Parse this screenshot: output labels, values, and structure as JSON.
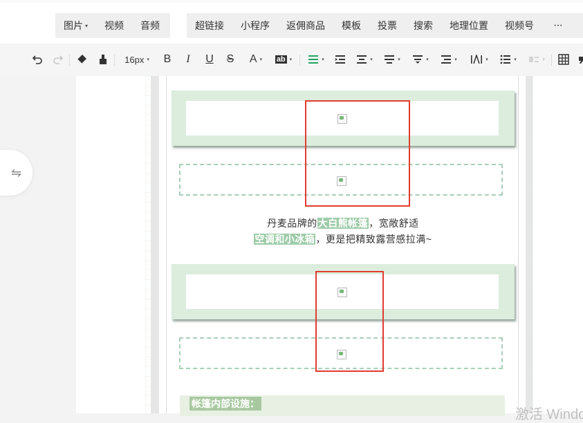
{
  "insert_menu": {
    "group1": [
      {
        "label": "图片",
        "has_dropdown": true
      },
      {
        "label": "视频",
        "has_dropdown": false
      },
      {
        "label": "音频",
        "has_dropdown": false
      }
    ],
    "group2": [
      "超链接",
      "小程序",
      "返佣商品",
      "模板",
      "投票",
      "搜索",
      "地理位置",
      "视频号"
    ],
    "more": "···"
  },
  "format_toolbar": {
    "undo_icon": "undo-icon",
    "redo_icon": "redo-icon",
    "font_size": "16px",
    "bold": "B",
    "italic": "I",
    "underline": "U",
    "strike": "S",
    "font_color": "A",
    "bg_color": "ab",
    "accent_color": "#21a362"
  },
  "sidebar_toggle_icon": "swap-arrows-icon",
  "content": {
    "line1_before": "丹麦品牌的",
    "line1_highlight": "大白熊帐篷",
    "line1_after": "，宽敞舒适",
    "line2_highlight": "空调和小冰箱",
    "line2_after": "，更是把精致露营感拉满~",
    "facility_label": "帐篷内部设施：",
    "highlight_color": "#9dcba9"
  },
  "watermark": "激活 Windo",
  "annotation_color": "#e03b2f"
}
